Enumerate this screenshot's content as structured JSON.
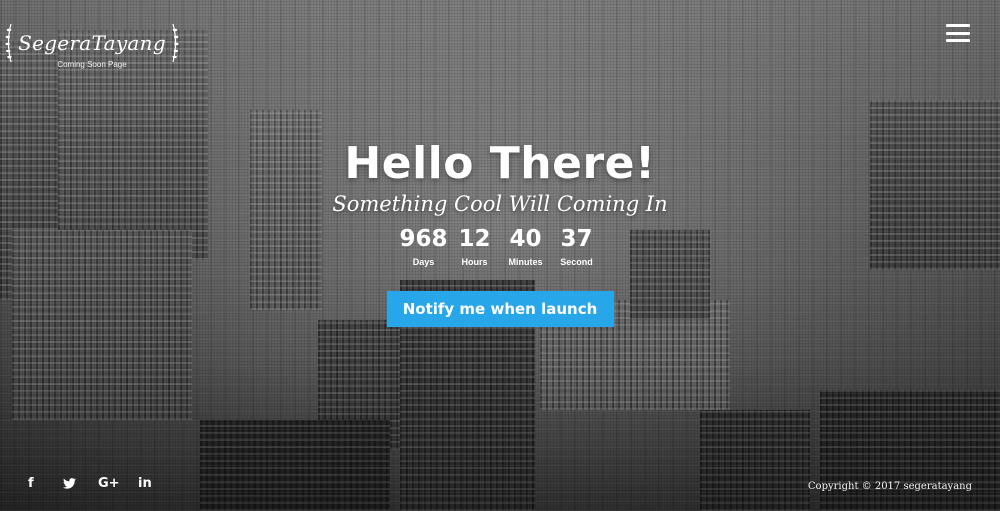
{
  "brand": {
    "name": "SegeraTayang",
    "tagline": "Coming Soon Page"
  },
  "nav": {
    "menu_icon": "hamburger-icon"
  },
  "hero": {
    "headline": "Hello There!",
    "subline": "Something Cool Will Coming In"
  },
  "countdown": [
    {
      "value": "968",
      "label": "Days"
    },
    {
      "value": "12",
      "label": "Hours"
    },
    {
      "value": "40",
      "label": "Minutes"
    },
    {
      "value": "37",
      "label": "Second"
    }
  ],
  "cta": {
    "label": "Notify me when launch",
    "color": "#27a6ea"
  },
  "social": [
    {
      "name": "facebook-icon",
      "text": "f"
    },
    {
      "name": "twitter-icon",
      "text": ""
    },
    {
      "name": "google-plus-icon",
      "text": "G+"
    },
    {
      "name": "linkedin-icon",
      "text": "in"
    }
  ],
  "footer": {
    "copyright": "Copyright © 2017 segeratayang"
  }
}
